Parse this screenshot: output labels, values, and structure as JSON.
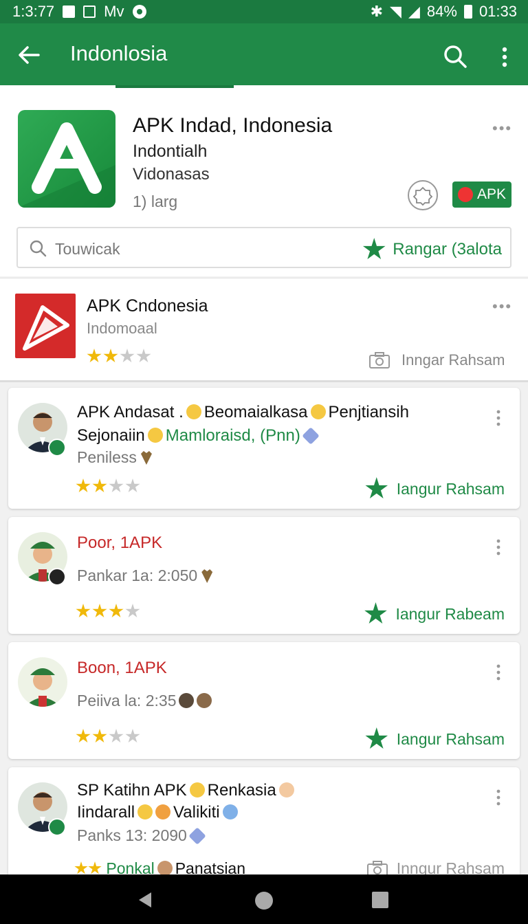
{
  "status": {
    "time": "1:3:77",
    "carrier": "Mv",
    "battery": "84%",
    "clock": "01:33"
  },
  "appbar": {
    "title": "Indonlosia"
  },
  "hero": {
    "title": "APK Indad, Indonesia",
    "sub1": "Indontialh",
    "sub2": "Vidonasas",
    "sub3": "1) larg",
    "apk_label": "APK"
  },
  "search": {
    "placeholder": "Touwicak",
    "rate_label": "Rangar (3alota"
  },
  "featured": {
    "title": "APK Cndonesia",
    "sub": "Indomoaal",
    "stars": 2,
    "action": "Inngar Rahsam"
  },
  "cards": [
    {
      "l1a": "APK Andasat .",
      "l1b": "Beomaialkasa",
      "l1c": "Penjtiansih",
      "l2a": "Sejonaiin",
      "l2b": "Mamloraisd, (Pnn)",
      "l3": "Peniless",
      "stars": 2,
      "action": "Iangur Rahsam"
    },
    {
      "title": "Poor, 1APK",
      "meta": "Pankar 1a: 2:050",
      "stars": 3,
      "action": "Iangur Rabeam"
    },
    {
      "title": "Boon, 1APK",
      "meta": "Peiiva la: 2:35",
      "stars": 2,
      "action": "Iangur Rahsam"
    },
    {
      "l1a": "SP Katihn APK",
      "l1b": "Renkasia",
      "l2a": "Iindarall",
      "l2b": "Valikiti",
      "l3": "Panks 13: 2090",
      "l4a": "Ponkal",
      "l4b": "Panatsian",
      "stars": 2,
      "action": "Inngur Rahsam"
    }
  ]
}
